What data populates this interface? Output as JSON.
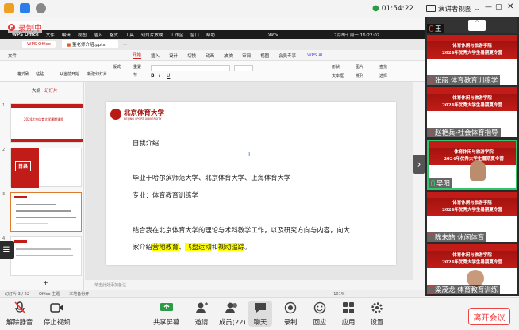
{
  "topbar": {
    "time": "01:54:22",
    "view_label": "演讲者视图"
  },
  "recording": {
    "label": "录制中"
  },
  "macbar": {
    "app": "WPS Office",
    "menus": [
      "文件",
      "编辑",
      "视图",
      "插入",
      "格式",
      "工具",
      "幻灯片放映",
      "工作区",
      "窗口",
      "帮助"
    ],
    "battery": "99%",
    "datetime": "7月8日 周一 16:22:07"
  },
  "wps": {
    "tab_home": "WPS Office",
    "doc_tab": "董老师介绍.pptx"
  },
  "ribbon": {
    "file": "文件",
    "tabs": [
      "开始",
      "插入",
      "设计",
      "切换",
      "动画",
      "放映",
      "审阅",
      "视图",
      "会员专享"
    ],
    "ai": "WPS AI",
    "tools": [
      "格式刷",
      "粘贴",
      "从当前开始",
      "新建幻灯片",
      "版式",
      "重置",
      "节"
    ],
    "right_tools": [
      "形状",
      "图片",
      "查找",
      "文本框",
      "排列",
      "选择"
    ]
  },
  "left_pane": {
    "tab_outline": "大纲",
    "tab_slides": "幻灯片",
    "thumb1_title": "2024北京体育大学暑期课程",
    "thumb2_label": "目录"
  },
  "slide": {
    "logo_cn": "北京体育大学",
    "logo_en": "BEIJING SPORT UNIVERSITY",
    "line1": "自我介绍",
    "line2": "毕业于哈尔滨师范大学、北京体育大学、上海体育大学",
    "line3": "专业：体育教育训练学",
    "line4": "结合我在北京体育大学的理论与术科教学工作，以及研究方向与内容，向大",
    "line5_pre": "家介绍",
    "line5_hl1": "营地教育",
    "line5_sep1": "、",
    "line5_hl2": "飞盘运动",
    "line5_sep2": "和",
    "line5_hl3": "视动追踪",
    "line5_end": "。"
  },
  "notes": {
    "placeholder": "单击此处添加备注"
  },
  "status": {
    "slide": "幻灯片 3 / 22",
    "theme": "Office 主题",
    "save": "本地备份开",
    "zoom": "101%"
  },
  "participants": [
    {
      "name": "王",
      "banner": ""
    },
    {
      "name": "张丽 体育教育训练学",
      "banner": "体育休闲与旅游学院\n2024年优秀大学生暑期夏令营"
    },
    {
      "name": "赵艳兵-社会体育指导",
      "banner": "体育休闲与旅游学院\n2024年优秀大学生暑期夏令营"
    },
    {
      "name": "吴阳",
      "banner": "体育休闲与旅游学院\n2024年优秀大学生暑期夏令营"
    },
    {
      "name": "陈未皓 休闲体育",
      "banner": "体育休闲与旅游学院\n2024年优秀大学生暑期夏令营"
    },
    {
      "name": "梁茂龙 体育教育训练",
      "banner": "体育休闲与旅游学院\n2024年优秀大学生暑期夏令营"
    }
  ],
  "toolbar": {
    "mute": "解除静音",
    "video": "停止视频",
    "share": "共享屏幕",
    "invite": "邀请",
    "members": "成员(22)",
    "chat": "聊天",
    "record": "录制",
    "reaction": "回应",
    "apps": "应用",
    "settings": "设置",
    "leave": "离开会议"
  },
  "colors": {
    "accent_red": "#c11c18",
    "leave_red": "#e33333",
    "highlight": "#ffff00"
  }
}
